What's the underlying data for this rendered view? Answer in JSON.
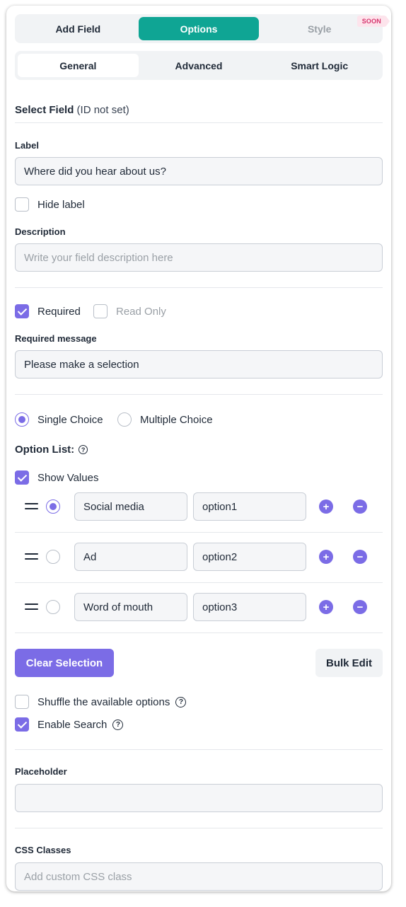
{
  "top_tabs": [
    {
      "label": "Add Field"
    },
    {
      "label": "Options"
    },
    {
      "label": "Style",
      "badge": "SOON"
    }
  ],
  "sub_tabs": [
    {
      "label": "General"
    },
    {
      "label": "Advanced"
    },
    {
      "label": "Smart Logic"
    }
  ],
  "header": {
    "title": "Select Field",
    "subtitle": "(ID not set)"
  },
  "label_field": {
    "label": "Label",
    "value": "Where did you hear about us?"
  },
  "hide_label": {
    "label": "Hide label",
    "checked": false
  },
  "description": {
    "label": "Description",
    "placeholder": "Write your field description here"
  },
  "required": {
    "label": "Required",
    "checked": true
  },
  "read_only": {
    "label": "Read Only",
    "checked": false
  },
  "required_message": {
    "label": "Required message",
    "value": "Please make a selection"
  },
  "choice_mode": {
    "single": "Single Choice",
    "multiple": "Multiple Choice",
    "selected": "single"
  },
  "option_list": {
    "label": "Option List:"
  },
  "show_values": {
    "label": "Show Values",
    "checked": true
  },
  "options": [
    {
      "label": "Social media",
      "value": "option1",
      "selected": true
    },
    {
      "label": "Ad",
      "value": "option2",
      "selected": false
    },
    {
      "label": "Word of mouth",
      "value": "option3",
      "selected": false
    }
  ],
  "buttons": {
    "clear_selection": "Clear Selection",
    "bulk_edit": "Bulk Edit"
  },
  "shuffle": {
    "label": "Shuffle the available options",
    "checked": false
  },
  "enable_search": {
    "label": "Enable Search",
    "checked": true
  },
  "placeholder_field": {
    "label": "Placeholder",
    "value": ""
  },
  "css_classes": {
    "label": "CSS Classes",
    "placeholder": "Add custom CSS class"
  },
  "icons": {
    "help": "?",
    "plus": "+",
    "minus": "−"
  },
  "colors": {
    "accent": "#7b6ce6",
    "teal": "#0fa594",
    "badge_bg": "#fde4ec",
    "badge_text": "#d6336c"
  }
}
